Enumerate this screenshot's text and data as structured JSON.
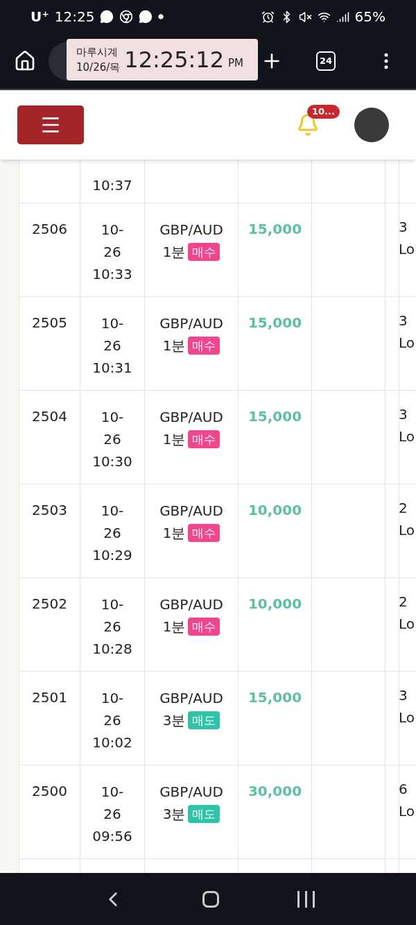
{
  "status_bar": {
    "carrier": "U⁺",
    "time": "12:25",
    "battery": "65%"
  },
  "browser": {
    "tab_count": "24"
  },
  "clock_overlay": {
    "title": "마루시계",
    "date": "10/26/목",
    "time": "12:25:12",
    "period": "PM"
  },
  "header": {
    "notification_count": "10..."
  },
  "table": {
    "partial_top_row": {
      "time": "10:37"
    },
    "rows": [
      {
        "id": "2506",
        "date": [
          "10-",
          "26",
          "10:33"
        ],
        "pair": "GBP/AUD",
        "interval": "1분",
        "side": {
          "label": "매수",
          "color": "#f2458e"
        },
        "amount": "15,000",
        "column_7": [
          "3",
          "Lo"
        ]
      },
      {
        "id": "2505",
        "date": [
          "10-",
          "26",
          "10:31"
        ],
        "pair": "GBP/AUD",
        "interval": "1분",
        "side": {
          "label": "매수",
          "color": "#f2458e"
        },
        "amount": "15,000",
        "column_7": [
          "3",
          "Lo"
        ]
      },
      {
        "id": "2504",
        "date": [
          "10-",
          "26",
          "10:30"
        ],
        "pair": "GBP/AUD",
        "interval": "1분",
        "side": {
          "label": "매수",
          "color": "#f2458e"
        },
        "amount": "15,000",
        "column_7": [
          "3",
          "Lo"
        ]
      },
      {
        "id": "2503",
        "date": [
          "10-",
          "26",
          "10:29"
        ],
        "pair": "GBP/AUD",
        "interval": "1분",
        "side": {
          "label": "매수",
          "color": "#f2458e"
        },
        "amount": "10,000",
        "column_7": [
          "2",
          "Lo"
        ]
      },
      {
        "id": "2502",
        "date": [
          "10-",
          "26",
          "10:28"
        ],
        "pair": "GBP/AUD",
        "interval": "1분",
        "side": {
          "label": "매수",
          "color": "#f2458e"
        },
        "amount": "10,000",
        "column_7": [
          "2",
          "Lo"
        ]
      },
      {
        "id": "2501",
        "date": [
          "10-",
          "26",
          "10:02"
        ],
        "pair": "GBP/AUD",
        "interval": "3분",
        "side": {
          "label": "매도",
          "color": "#2ec4aa"
        },
        "amount": "15,000",
        "column_7": [
          "3",
          "Lo"
        ]
      },
      {
        "id": "2500",
        "date": [
          "10-",
          "26",
          "09:56"
        ],
        "pair": "GBP/AUD",
        "interval": "3분",
        "side": {
          "label": "매도",
          "color": "#2ec4aa"
        },
        "amount": "30,000",
        "column_7": [
          "6",
          "Lo"
        ]
      }
    ]
  }
}
